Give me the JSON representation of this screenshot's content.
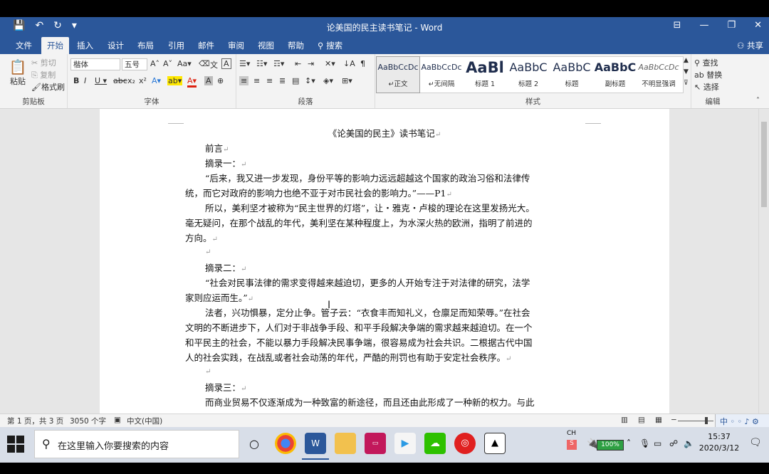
{
  "window": {
    "title": "论美国的民主读书笔记 - Word",
    "controls": [
      "⊟",
      "—",
      "❐",
      "✕"
    ]
  },
  "ribbon_tabs": {
    "file": "文件",
    "home": "开始",
    "insert": "插入",
    "design": "设计",
    "layout": "布局",
    "references": "引用",
    "mailings": "邮件",
    "review": "审阅",
    "view": "视图",
    "help": "帮助",
    "search": "搜索",
    "share": "共享"
  },
  "clipboard": {
    "paste": "粘贴",
    "cut": "剪切",
    "copy": "复制",
    "format_painter": "格式刷",
    "label": "剪贴板"
  },
  "font_group": {
    "font_name": "楷体",
    "font_size": "五号",
    "label": "字体"
  },
  "paragraph_group": {
    "label": "段落"
  },
  "styles_group": {
    "label": "样式",
    "items": [
      {
        "sample": "AaBbCcDc",
        "name": "↵正文"
      },
      {
        "sample": "AaBbCcDc",
        "name": "↵无间隔"
      },
      {
        "sample": "AaBl",
        "name": "标题 1"
      },
      {
        "sample": "AaBbC",
        "name": "标题 2"
      },
      {
        "sample": "AaBbC",
        "name": "标题"
      },
      {
        "sample": "AaBbC",
        "name": "副标题"
      },
      {
        "sample": "AaBbCcDc",
        "name": "不明显强调"
      }
    ]
  },
  "editing_group": {
    "find": "查找",
    "replace": "替换",
    "select": "选择",
    "label": "编辑"
  },
  "document": {
    "title": "《论美国的民主》读书笔记",
    "lines": [
      "前言",
      "摘录一：",
      "“后来，我又进一步发现，身份平等的影响力远远超越这个国家的政治习俗和法律传",
      "统，而它对政府的影响力也绝不亚于对市民社会的影响力。”——P1",
      "所以，美利坚才被称为“民主世界的灯塔”，让・雅克・卢梭的理论在这里发扬光大。",
      "毫无疑问，在那个战乱的年代，美利坚在某种程度上，为水深火热的欧洲，指明了前进的",
      "方向。",
      "摘录二：",
      "“社会对民事法律的需求变得越来越迫切，更多的人开始专注于对法律的研究，法学",
      "家则应运而生。”",
      "法者，兴功惧暴，定分止争。管子云：“衣食丰而知礼义，仓廪足而知荣辱。”在社会",
      "文明的不断进步下，人们对于非战争手段、和平手段解决争端的需求越来越迫切。在一个",
      "和平民主的社会，不能以暴力手段解决民事争端，很容易成为社会共识。二根据古代中国",
      "人的社会实践，在战乱或者社会动荡的年代，严酷的刑罚也有助于安定社会秩序。",
      "摘录三：",
      "而商业贸易不仅逐渐成为一种致富的新途径，而且还由此形成了一种新的权力。与此"
    ]
  },
  "statusbar": {
    "page": "第 1 页，共 3 页",
    "words": "3050 个字",
    "language": "中文(中国)",
    "ime": "中 ◦ ◦ ♪ ⚙"
  },
  "taskbar": {
    "search_placeholder": "在这里输入你要搜索的内容",
    "battery": "100%",
    "time": "15:37",
    "date": "2020/3/12",
    "lang": "CH"
  }
}
